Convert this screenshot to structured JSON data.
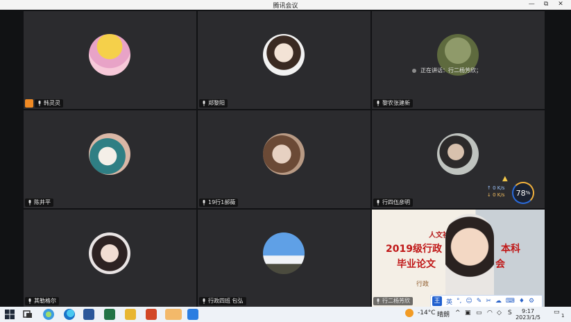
{
  "window": {
    "title": "腾讯会议",
    "controls": [
      "—",
      "⧉",
      "✕"
    ]
  },
  "participants": [
    {
      "name": "韩灵灵",
      "host": true
    },
    {
      "name": "郑黎阳"
    },
    {
      "name": "黎农张建新"
    },
    {
      "name": "陈井平"
    },
    {
      "name": "19行1郝薇"
    },
    {
      "name": "行四伍彦明"
    },
    {
      "name": "其勒格尔"
    },
    {
      "name": "行政四班 包弘"
    },
    {
      "name": "行二杨芳欣",
      "video": true
    }
  ],
  "speaking": {
    "text": "正在讲话：行二杨芳欣；"
  },
  "video_text": {
    "line1": "人文社",
    "line2": "2019级行政",
    "line2b": "本科",
    "line3": "毕业论文",
    "line3b": "会",
    "line4": "行政"
  },
  "network": {
    "up": "0 K/s",
    "down": "0 K/s",
    "cpu": "78",
    "cpu_unit": "%"
  },
  "ime": {
    "w": "王",
    "lang": "英"
  },
  "taskbar": {
    "weather": "-14°C",
    "weather_desc": "晴朗",
    "time": "9:17",
    "date": "2023/1/5",
    "notif": "1"
  },
  "colors": {
    "accent": "#2a62c8",
    "active_border": "#55c04a",
    "host": "#f08a24"
  }
}
